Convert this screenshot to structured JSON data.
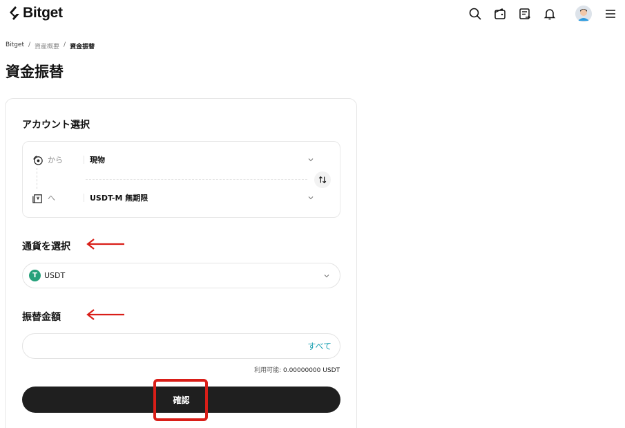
{
  "header": {
    "brand": "Bitget",
    "icons": [
      "search-icon",
      "wallet-icon",
      "orders-icon",
      "bell-icon",
      "avatar",
      "menu-icon"
    ]
  },
  "breadcrumb": {
    "home": "Bitget",
    "parent": "資産概要",
    "current": "資金振替"
  },
  "page": {
    "title": "資金振替"
  },
  "account": {
    "section_label": "アカウント選択",
    "from_label": "から",
    "from_value": "現物",
    "to_label": "へ",
    "to_value": "USDT-M 無期限"
  },
  "currency": {
    "section_label": "通貨を選択",
    "selected": "USDT",
    "icon_letter": "T"
  },
  "amount": {
    "section_label": "振替金額",
    "value": "",
    "all_label": "すべて",
    "available_label": "利用可能:",
    "available_value": "0.00000000",
    "available_unit": "USDT"
  },
  "confirm": {
    "label": "確認"
  },
  "colors": {
    "accent_teal": "#1fa2b3",
    "tether_green": "#26a17b",
    "button_dark": "#1f1f1f",
    "annotation_red": "#d91e18"
  }
}
